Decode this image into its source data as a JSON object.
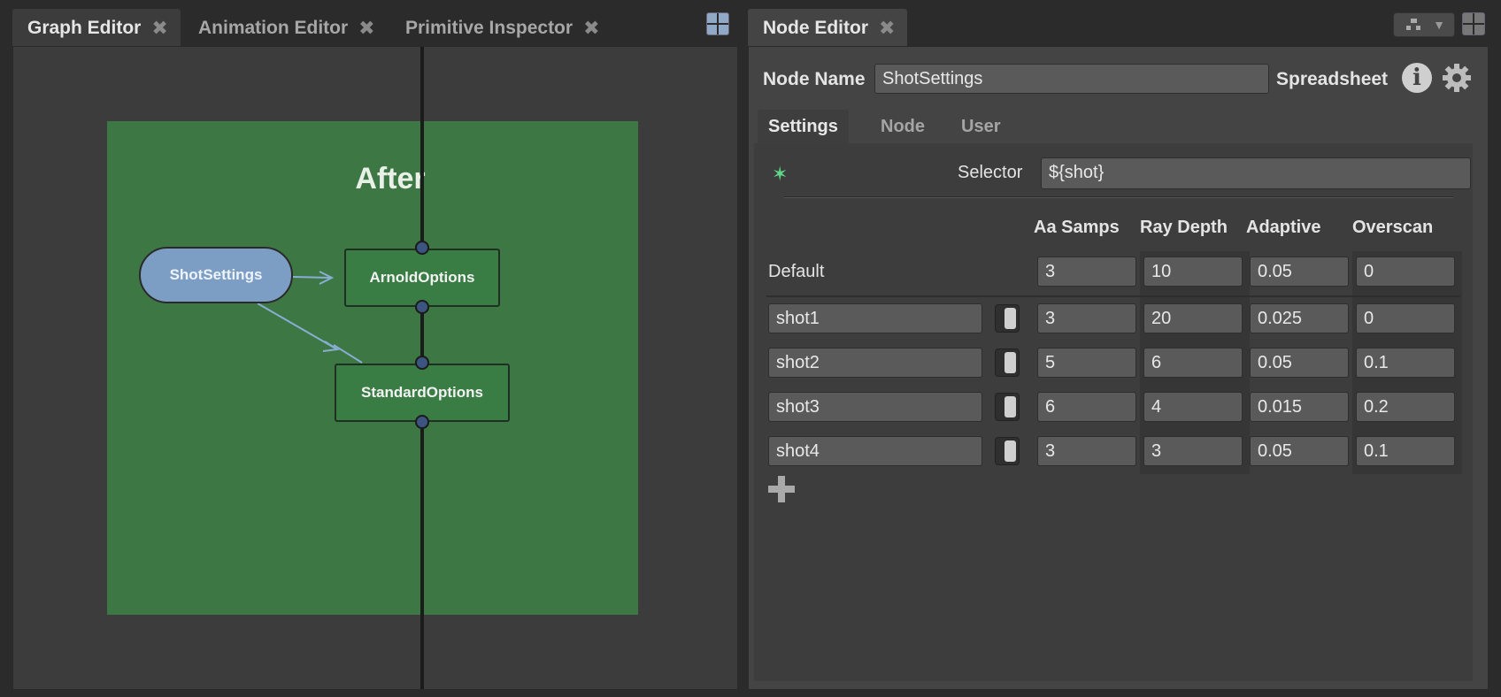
{
  "tabs": {
    "left": [
      {
        "label": "Graph Editor"
      },
      {
        "label": "Animation Editor"
      },
      {
        "label": "Primitive Inspector"
      }
    ],
    "right": [
      {
        "label": "Node Editor"
      }
    ],
    "close_glyph": "✖"
  },
  "graph": {
    "backdrop_title": "After",
    "backdrop_color": "#3d7744",
    "nodes": {
      "shot_settings": "ShotSettings",
      "arnold_options": "ArnoldOptions",
      "standard_options": "StandardOptions"
    }
  },
  "node_editor": {
    "name_label": "Node Name",
    "name_value": "ShotSettings",
    "type_label": "Spreadsheet",
    "info_glyph": "i",
    "tabs": [
      "Settings",
      "Node",
      "User"
    ],
    "selector_label": "Selector",
    "selector_value": "${shot}",
    "wildcard_glyph": "✶",
    "columns": [
      "Aa Samps",
      "Ray Depth",
      "Adaptive",
      "Overscan"
    ],
    "default_row": {
      "label": "Default",
      "values": [
        "3",
        "10",
        "0.05",
        "0"
      ]
    },
    "rows": [
      {
        "name": "shot1",
        "enabled": true,
        "values": [
          "3",
          "20",
          "0.025",
          "0"
        ]
      },
      {
        "name": "shot2",
        "enabled": true,
        "values": [
          "5",
          "6",
          "0.05",
          "0.1"
        ]
      },
      {
        "name": "shot3",
        "enabled": true,
        "values": [
          "6",
          "4",
          "0.015",
          "0.2"
        ]
      },
      {
        "name": "shot4",
        "enabled": true,
        "values": [
          "3",
          "3",
          "0.05",
          "0.1"
        ]
      }
    ],
    "accent_color": "#5fd68a",
    "dropdown_arrow": "▼"
  }
}
